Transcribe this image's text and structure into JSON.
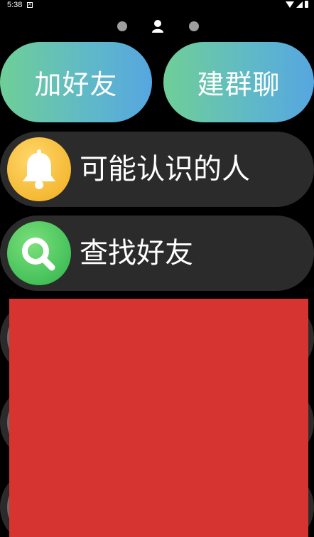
{
  "status_bar": {
    "time": "5:38",
    "notification_glyph": "A",
    "icons": [
      "wifi-icon",
      "signal-icon",
      "battery-icon"
    ]
  },
  "page_indicator": {
    "active_icon": "person-icon",
    "pages": 3,
    "active_index": 1
  },
  "actions": {
    "add_friend": "加好友",
    "create_group": "建群聊"
  },
  "list": {
    "items": [
      {
        "label": "可能认识的人",
        "icon": "bell-icon",
        "color": "#f5b935"
      },
      {
        "label": "查找好友",
        "icon": "search-icon",
        "color": "#45c15a"
      }
    ]
  },
  "colors": {
    "background": "#000000",
    "row_background": "#2b2b2b",
    "gradient_start": "#6fcf97",
    "gradient_end": "#56a6e0",
    "redaction": "#d63431"
  }
}
